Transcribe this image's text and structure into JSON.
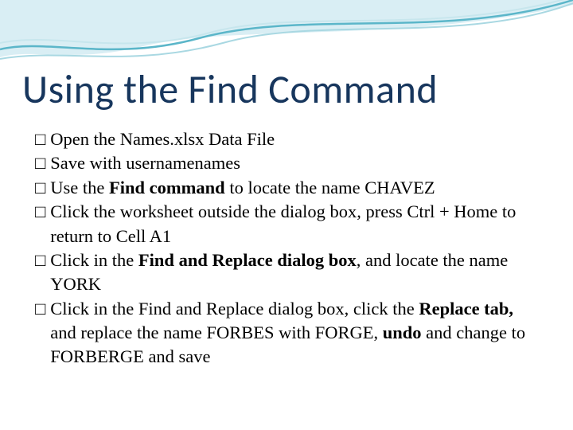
{
  "title": "Using the Find Command",
  "bullets": [
    {
      "pre": "Open the Names.xlsx Data File"
    },
    {
      "pre": "Save with usernamenames"
    },
    {
      "pre": "Use the ",
      "b1": "Find command",
      "post1": " to locate the name CHAVEZ"
    },
    {
      "pre": "Click the worksheet outside the dialog box, press Ctrl + Home to return to Cell A1"
    },
    {
      "pre": "Click in the ",
      "b1": "Find and Replace dialog box",
      "post1": ", and locate the name YORK"
    },
    {
      "pre": "Click in the Find and Replace dialog box, click the ",
      "b1": "Replace tab,",
      "post1": " and replace the name FORBES with FORGE, ",
      "b2": "undo",
      "post2": " and change to FORBERGE and save"
    }
  ],
  "box": "□"
}
